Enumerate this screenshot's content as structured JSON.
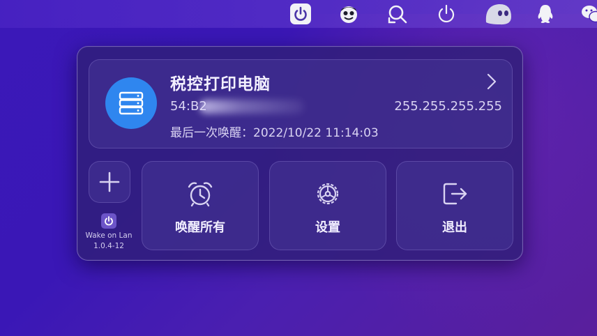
{
  "menubar": {
    "icons": [
      "wake-on-lan-app-icon",
      "face-app-icon",
      "search-capture-icon",
      "power-icon",
      "ghost-app-icon",
      "qq-penguin-icon",
      "wechat-icon"
    ]
  },
  "device": {
    "name": "税控打印电脑",
    "mac_prefix": "54:B2",
    "ip": "255.255.255.255",
    "last_wake_label": "最后一次唤醒：",
    "last_wake_time": "2022/10/22 11:14:03",
    "icon": "server-icon"
  },
  "actions": {
    "wake_all": "唤醒所有",
    "settings": "设置",
    "quit": "退出"
  },
  "app": {
    "name": "Wake on Lan",
    "version": "1.0.4-12"
  },
  "colors": {
    "device_avatar": "#2f86ef",
    "panel_bg": "#301e78"
  }
}
